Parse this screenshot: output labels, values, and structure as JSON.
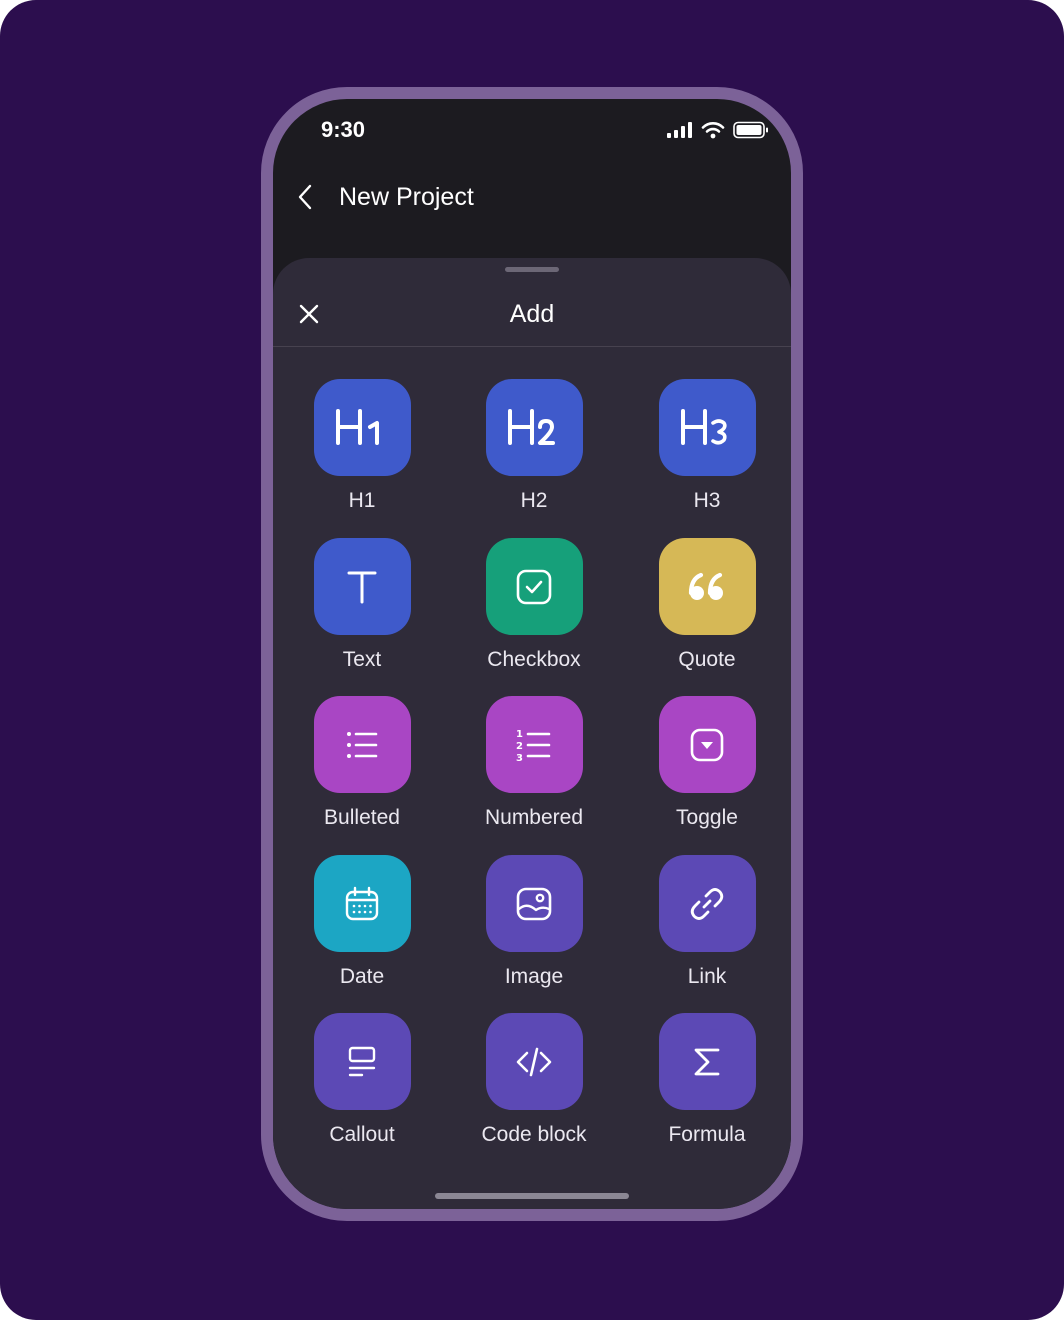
{
  "status_bar": {
    "time": "9:30"
  },
  "header": {
    "title": "New Project"
  },
  "sheet": {
    "title": "Add"
  },
  "colors": {
    "background": "#2c0e4e",
    "phone_frame": "#7c6298",
    "sheet": "#2f2b39",
    "blue": "#3f5acb",
    "green": "#16a07a",
    "yellow": "#d6b856",
    "magenta": "#a946c4",
    "teal": "#1ca6c4",
    "purple": "#5c49b5"
  },
  "blocks": [
    {
      "label": "H1",
      "icon": "heading-1-icon",
      "color": "#3f5acb"
    },
    {
      "label": "H2",
      "icon": "heading-2-icon",
      "color": "#3f5acb"
    },
    {
      "label": "H3",
      "icon": "heading-3-icon",
      "color": "#3f5acb"
    },
    {
      "label": "Text",
      "icon": "text-icon",
      "color": "#3f5acb"
    },
    {
      "label": "Checkbox",
      "icon": "checkbox-icon",
      "color": "#16a07a"
    },
    {
      "label": "Quote",
      "icon": "quote-icon",
      "color": "#d6b856"
    },
    {
      "label": "Bulleted",
      "icon": "bulleted-list-icon",
      "color": "#a946c4"
    },
    {
      "label": "Numbered",
      "icon": "numbered-list-icon",
      "color": "#a946c4"
    },
    {
      "label": "Toggle",
      "icon": "toggle-icon",
      "color": "#a946c4"
    },
    {
      "label": "Date",
      "icon": "calendar-icon",
      "color": "#1ca6c4"
    },
    {
      "label": "Image",
      "icon": "image-icon",
      "color": "#5c49b5"
    },
    {
      "label": "Link",
      "icon": "link-icon",
      "color": "#5c49b5"
    },
    {
      "label": "Callout",
      "icon": "callout-icon",
      "color": "#5c49b5"
    },
    {
      "label": "Code block",
      "icon": "code-icon",
      "color": "#5c49b5"
    },
    {
      "label": "Formula",
      "icon": "sigma-icon",
      "color": "#5c49b5"
    }
  ]
}
